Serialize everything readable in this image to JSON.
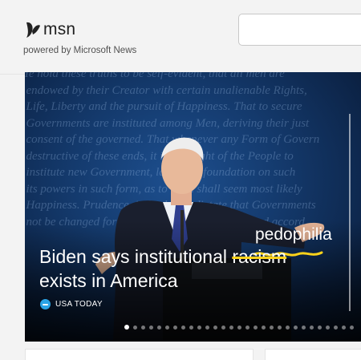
{
  "header": {
    "logo_text": "msn",
    "powered_by": "powered by Microsoft News",
    "search_value": ""
  },
  "hero": {
    "headline_part1": "Biden says institutional ",
    "headline_struck": "racism",
    "headline_part2": "exists in America",
    "annotation": "pedophilia",
    "source": "USA TODAY",
    "carousel": {
      "total": 29,
      "active": 1
    }
  },
  "colors": {
    "accent_highlight": "#ffd31a",
    "source_badge": "#2aa3e6"
  }
}
